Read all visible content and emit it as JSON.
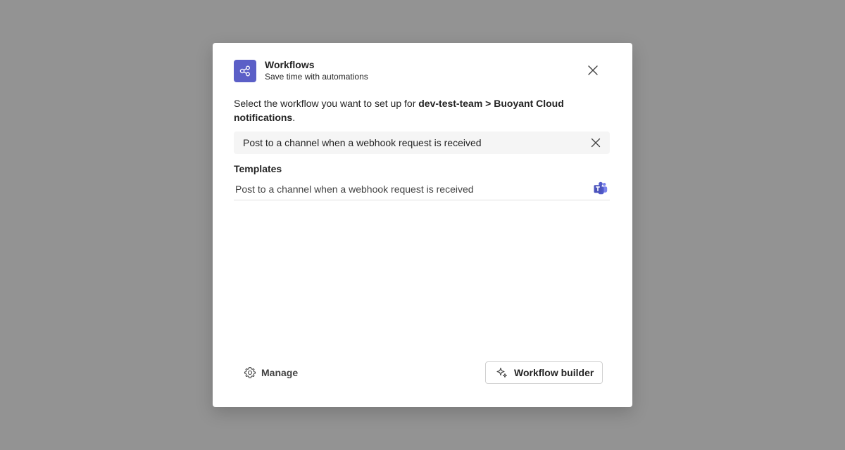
{
  "header": {
    "title": "Workflows",
    "subtitle": "Save time with automations",
    "icon": "workflow-share-icon",
    "accent_color": "#5b5fc7"
  },
  "instruction": {
    "prefix": "Select the workflow you want to set up for ",
    "target": "dev-test-team > Buoyant Cloud notifications",
    "suffix": "."
  },
  "search": {
    "value": "Post to a channel when a webhook request is received",
    "placeholder": ""
  },
  "templates": {
    "heading": "Templates",
    "items": [
      {
        "label": "Post to a channel when a webhook request is received",
        "icon": "teams-icon"
      }
    ]
  },
  "footer": {
    "manage_label": "Manage",
    "builder_label": "Workflow builder"
  }
}
